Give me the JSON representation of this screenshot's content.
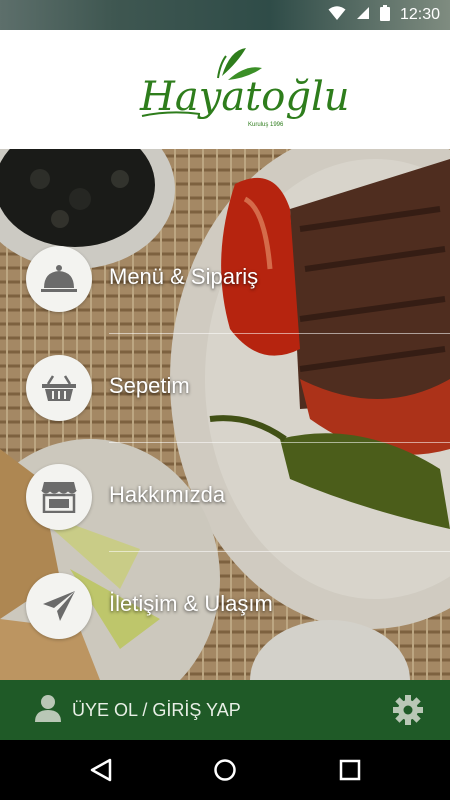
{
  "status_bar": {
    "time": "12:30",
    "icons": [
      "wifi-icon",
      "signal-icon",
      "battery-icon"
    ]
  },
  "header": {
    "logo_text": "Hayatoğlu",
    "logo_tagline": "Kuruluş 1996"
  },
  "menu": {
    "items": [
      {
        "label": "Menü & Sipariş",
        "icon": "cloche-icon"
      },
      {
        "label": "Sepetim",
        "icon": "basket-icon"
      },
      {
        "label": "Hakkımızda",
        "icon": "store-icon"
      },
      {
        "label": "İletişim & Ulaşım",
        "icon": "paper-plane-icon"
      }
    ]
  },
  "bottom_bar": {
    "login_label": "ÜYE OL / GİRİŞ YAP",
    "icons": [
      "user-icon",
      "settings-gear-icon"
    ]
  },
  "nav_bar": {
    "icons": [
      "back-icon",
      "home-icon",
      "recents-icon"
    ]
  },
  "colors": {
    "brand_green": "#1f5a27",
    "logo_green": "#2e7d1c",
    "circle_bg": "#f3f3f0",
    "icon_gray": "#6b6b6b"
  }
}
